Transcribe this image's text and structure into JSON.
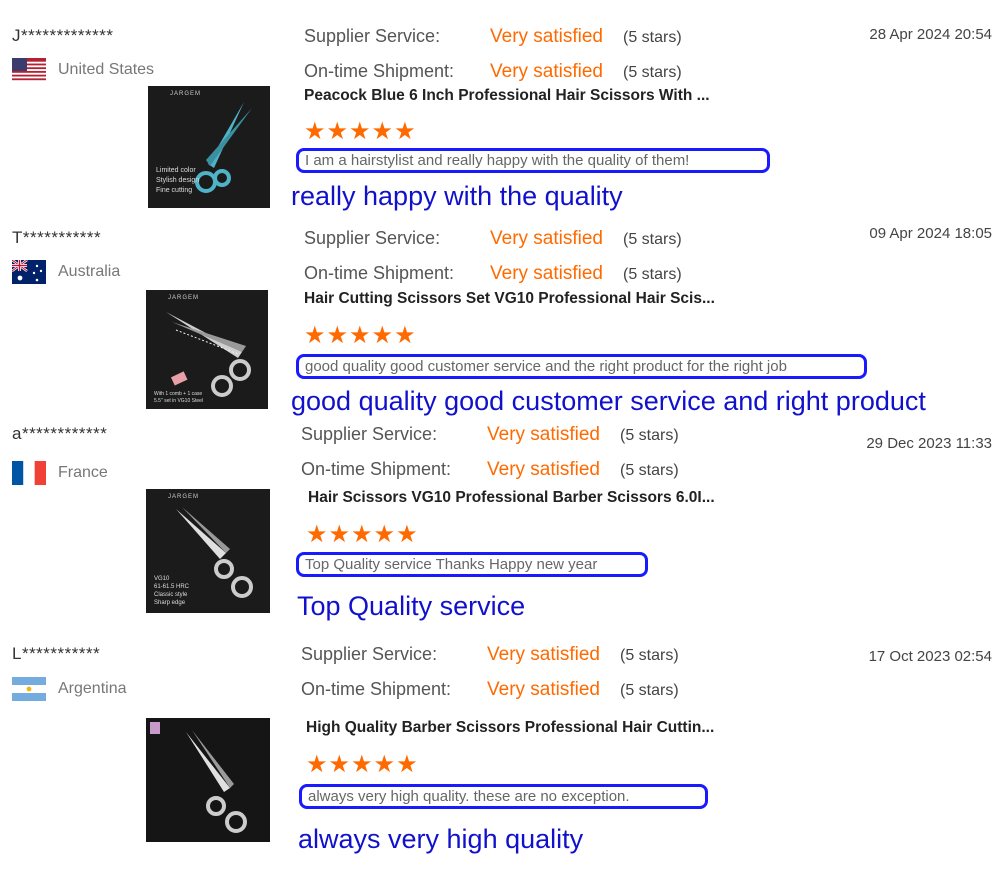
{
  "labels": {
    "supplier_service": "Supplier Service:",
    "ontime_shipment": "On-time Shipment:"
  },
  "reviews": [
    {
      "user": "J*************",
      "country": "United States",
      "flag": "us-flag",
      "date": "28 Apr 2024 20:54",
      "supplier_value": "Very satisfied",
      "supplier_stars": "(5 stars)",
      "shipment_value": "Very satisfied",
      "shipment_stars": "(5 stars)",
      "product": "Peacock Blue 6 Inch Professional Hair Scissors With ...",
      "rating": "★★★★★",
      "rating_value": 5,
      "comment": "I am a hairstylist and really happy with the quality of them!",
      "note": "really happy with the quality",
      "thumb": {
        "brand": "JARGEM",
        "caption": "Limited color\nStylish design\nFine cutting",
        "blade_color": "#4fb3c8"
      }
    },
    {
      "user": "T***********",
      "country": "Australia",
      "flag": "au-flag",
      "date": "09 Apr 2024 18:05",
      "supplier_value": "Very satisfied",
      "supplier_stars": "(5 stars)",
      "shipment_value": "Very satisfied",
      "shipment_stars": "(5 stars)",
      "product": "Hair Cutting Scissors Set VG10 Professional Hair Scis...",
      "rating": "★★★★★",
      "rating_value": 5,
      "comment": "good quality good customer service and the right product for the right job",
      "note": "good quality good customer service and right product",
      "thumb": {
        "brand": "JARGEM",
        "caption": "With 1 comb + 1 case\n5.5\" set in VG10 Steel",
        "blade_color": "#cfcfcf"
      }
    },
    {
      "user": "a************",
      "country": "France",
      "flag": "fr-flag",
      "date": "29 Dec 2023 11:33",
      "supplier_value": "Very satisfied",
      "supplier_stars": "(5 stars)",
      "shipment_value": "Very satisfied",
      "shipment_stars": "(5 stars)",
      "product": "Hair Scissors VG10 Professional Barber Scissors 6.0I...",
      "rating": "★★★★★",
      "rating_value": 5,
      "comment": "Top Quality service Thanks Happy new year",
      "note": "Top Quality service",
      "thumb": {
        "brand": "JARGEM",
        "caption": "VG10\n61-61.5 HRC\nClassic style\nSharp edge",
        "blade_color": "#d9d9d9"
      }
    },
    {
      "user": "L***********",
      "country": "Argentina",
      "flag": "ar-flag",
      "date": "17 Oct 2023 02:54",
      "supplier_value": "Very satisfied",
      "supplier_stars": "(5 stars)",
      "shipment_value": "Very satisfied",
      "shipment_stars": "(5 stars)",
      "product": "High Quality Barber Scissors Professional Hair Cuttin...",
      "rating": "★★★★★",
      "rating_value": 5,
      "comment": "always very high quality.  these are no exception.",
      "note": "always very high quality",
      "thumb": {
        "brand": "",
        "caption": "",
        "blade_color": "#d9d9d9"
      }
    }
  ],
  "colors": {
    "accent_orange": "#ff6a00",
    "annotation_blue": "#1111cc",
    "box_border": "#1a1aff"
  }
}
